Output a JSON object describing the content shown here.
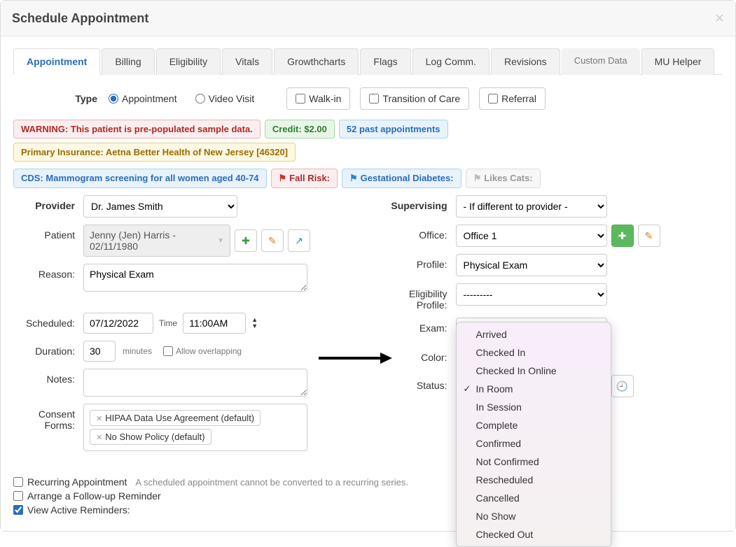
{
  "title": "Schedule Appointment",
  "tabs": {
    "appointment": "Appointment",
    "billing": "Billing",
    "eligibility": "Eligibility",
    "vitals": "Vitals",
    "growthcharts": "Growthcharts",
    "flags": "Flags",
    "logcomm": "Log Comm.",
    "revisions": "Revisions",
    "custom": "Custom Data",
    "muhelper": "MU Helper"
  },
  "type": {
    "label": "Type",
    "appointment": "Appointment",
    "video": "Video Visit",
    "walkin": "Walk-in",
    "transition": "Transition of Care",
    "referral": "Referral"
  },
  "badges": {
    "warning": "WARNING: This patient is pre-populated sample data.",
    "credit_label": "Credit: ",
    "credit_value": "$2.00",
    "past": "52 past appointments",
    "insurance": "Primary Insurance: Aetna Better Health of New Jersey [46320]",
    "cds_label": "CDS: ",
    "cds_link": "Mammogram screening for all women aged 40-74",
    "fallrisk": "Fall Risk",
    "gestational": "Gestational Diabetes",
    "likescats": "Likes Cats"
  },
  "left": {
    "provider_label": "Provider",
    "provider_value": "Dr. James Smith",
    "patient_label": "Patient",
    "patient_value": "Jenny (Jen) Harris - 02/11/1980",
    "reason_label": "Reason:",
    "reason_value": "Physical Exam",
    "scheduled_label": "Scheduled:",
    "scheduled_date": "07/12/2022",
    "scheduled_time_label": "Time",
    "scheduled_time": "11:00AM",
    "duration_label": "Duration:",
    "duration_value": "30",
    "duration_minutes": "minutes",
    "overlap": "Allow overlapping",
    "notes_label": "Notes:",
    "notes_value": "",
    "consent_label": "Consent Forms:",
    "consent1": "HIPAA Data Use Agreement (default)",
    "consent2": "No Show Policy (default)"
  },
  "right": {
    "supervising_label": "Supervising",
    "supervising_value": "- If different to provider -",
    "office_label": "Office:",
    "office_value": "Office 1",
    "profile_label": "Profile:",
    "profile_value": "Physical Exam",
    "elig_label": "Eligibility Profile:",
    "elig_value": "---------",
    "exam_label": "Exam:",
    "color_label": "Color:",
    "status_label": "Status:"
  },
  "status_options": [
    "Arrived",
    "Checked In",
    "Checked In Online",
    "In Room",
    "In Session",
    "Complete",
    "Confirmed",
    "Not Confirmed",
    "Rescheduled",
    "Cancelled",
    "No Show",
    "Checked Out"
  ],
  "status_selected": "In Room",
  "bottom": {
    "recurring": "Recurring Appointment",
    "recurring_hint": "A scheduled appointment cannot be converted to a recurring series.",
    "followup": "Arrange a Follow-up Reminder",
    "reminders": "View Active Reminders:"
  }
}
